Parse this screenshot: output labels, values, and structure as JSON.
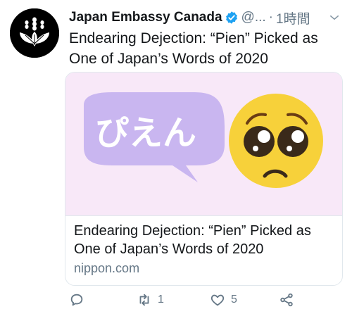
{
  "tweet": {
    "author_name": "Japan Embassy Canada",
    "handle": "@...",
    "separator": "·",
    "time": "1時間",
    "text": "Endearing Dejection: “Pien” Picked as One of Japan’s Words of 2020",
    "card": {
      "image_text": "ぴえん",
      "title": "Endearing Dejection: “Pien” Picked as One of Japan’s Words of 2020",
      "domain": "nippon.com"
    },
    "actions": {
      "reply_count": "",
      "retweet_count": "1",
      "like_count": "5"
    }
  },
  "colors": {
    "text_primary": "#14171a",
    "text_secondary": "#657786",
    "verified_blue": "#1da1f2",
    "bubble_purple": "#c9b6f0",
    "emoji_yellow": "#f7d13a",
    "card_bg": "#f8e8f8"
  },
  "icons": {
    "avatar": "paulownia-crest-icon",
    "verified": "verified-badge-icon",
    "menu": "chevron-down-icon",
    "reply": "reply-icon",
    "retweet": "retweet-icon",
    "like": "heart-icon",
    "share": "share-icon"
  }
}
